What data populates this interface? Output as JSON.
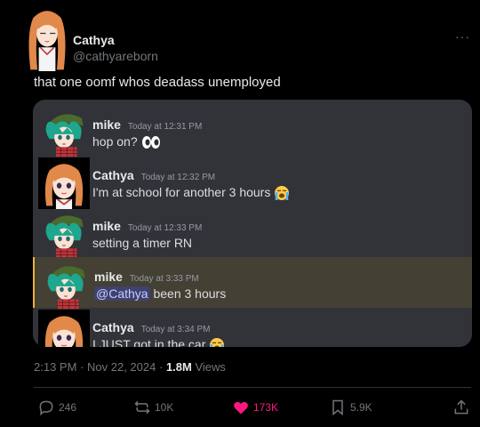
{
  "tweet": {
    "display_name": "Cathya",
    "handle": "@cathyareborn",
    "text": "that one oomf whos deadass unemployed",
    "more": "···",
    "meta": {
      "time": "2:13 PM",
      "sep1": "·",
      "date": "Nov 22, 2024",
      "sep2": "·",
      "views_count": "1.8M",
      "views_label": "Views"
    },
    "actions": {
      "replies": "246",
      "reposts": "10K",
      "likes": "173K",
      "bookmarks": "5.9K"
    }
  },
  "discord": {
    "messages": [
      {
        "author": "mike",
        "time": "Today at 12:31 PM",
        "text": "hop on?",
        "emoji": "eyes"
      },
      {
        "author": "Cathya",
        "time": "Today at 12:32 PM",
        "text": "I'm at school for another 3 hours",
        "emoji": "loudly-crying"
      },
      {
        "author": "mike",
        "time": "Today at 12:33 PM",
        "text": "setting a timer RN"
      },
      {
        "author": "mike",
        "time": "Today at 3:33 PM",
        "mention": "@Cathya",
        "text": " been 3 hours",
        "highlighted": true
      },
      {
        "author": "Cathya",
        "time": "Today at 3:34 PM",
        "text": "I JUST got in the car",
        "emoji": "loudly-crying"
      }
    ]
  },
  "colors": {
    "background": "#000000",
    "discord_bg": "#313338",
    "mention_bg": "#3e4270",
    "highlight_bg": "#444034",
    "like": "#f91880",
    "muted": "#71767b"
  }
}
